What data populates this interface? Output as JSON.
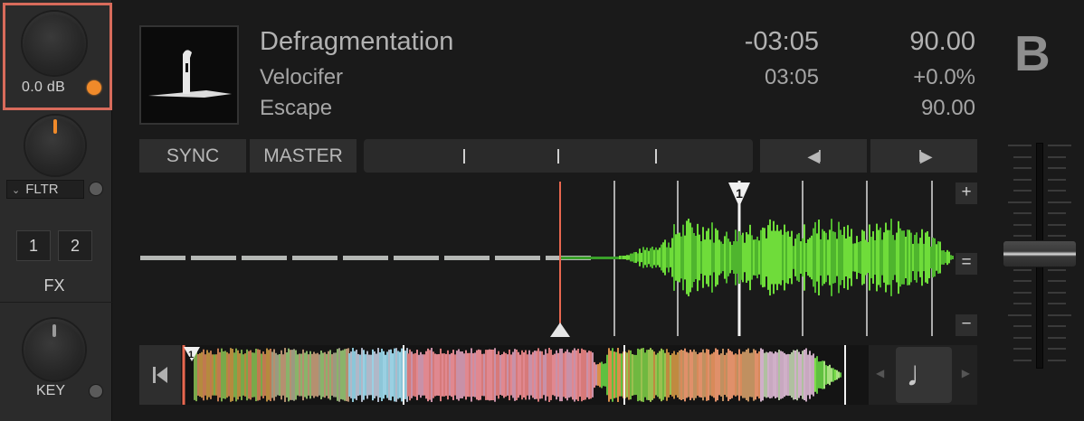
{
  "deck": {
    "letter": "B",
    "title": "Defragmentation",
    "artist": "Velocifer",
    "album": "Escape",
    "time_remaining": "-03:05",
    "time_elapsed": "03:05",
    "bpm": "90.00",
    "tempo_offset": "+0.0%",
    "bpm_original": "90.00"
  },
  "left_panel": {
    "gain_label": "0.0 dB",
    "filter_label": "FLTR",
    "fx_buttons": [
      "1",
      "2"
    ],
    "fx_label": "FX",
    "key_label": "KEY"
  },
  "transport": {
    "sync_label": "SYNC",
    "master_label": "MASTER",
    "beatjump_back_icon": "◀Ⅰ",
    "beatjump_fwd_icon": "Ⅰ▶"
  },
  "waveform": {
    "cue_number": "1",
    "zoom_in_label": "+",
    "zoom_reset_label": "=",
    "zoom_out_label": "−"
  },
  "overview": {
    "cue_number": "1",
    "jump_start_icon": "skip-to-start-icon",
    "cue_slot_icon": "music-note-icon"
  },
  "colors": {
    "gain_highlight": "#d86b5b",
    "waveform_green": "#6fdc3a",
    "playhead_red": "#e8674f",
    "led_orange": "#f08a2a"
  },
  "tempo_fader": {
    "position": 0.5
  }
}
